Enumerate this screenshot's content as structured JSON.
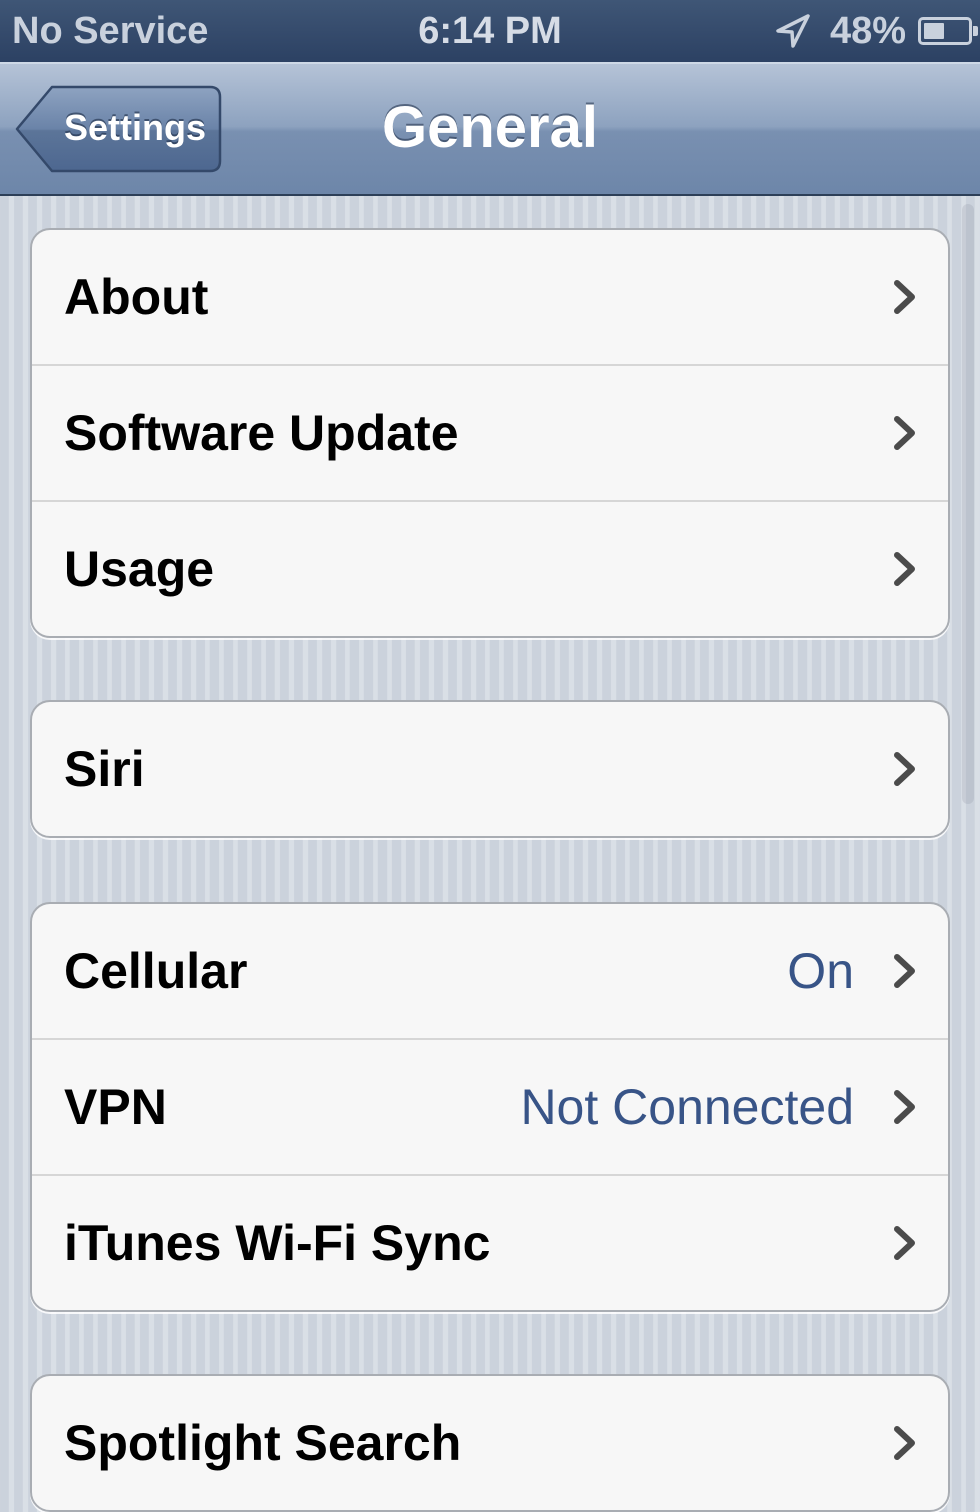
{
  "status_bar": {
    "carrier": "No Service",
    "time": "6:14 PM",
    "battery_percent": "48%",
    "battery_level": 0.48,
    "location_icon": "location-arrow-icon",
    "battery_icon": "battery-icon"
  },
  "nav_bar": {
    "back_label": "Settings",
    "title": "General"
  },
  "groups": [
    {
      "rows": [
        {
          "label": "About",
          "value": "",
          "icon": "chevron-right-icon"
        },
        {
          "label": "Software Update",
          "value": "",
          "icon": "chevron-right-icon"
        },
        {
          "label": "Usage",
          "value": "",
          "icon": "chevron-right-icon"
        }
      ]
    },
    {
      "rows": [
        {
          "label": "Siri",
          "value": "",
          "icon": "chevron-right-icon"
        }
      ]
    },
    {
      "rows": [
        {
          "label": "Cellular",
          "value": "On",
          "icon": "chevron-right-icon"
        },
        {
          "label": "VPN",
          "value": "Not Connected",
          "icon": "chevron-right-icon"
        },
        {
          "label": "iTunes Wi-Fi Sync",
          "value": "",
          "icon": "chevron-right-icon"
        }
      ]
    },
    {
      "rows": [
        {
          "label": "Spotlight Search",
          "value": "",
          "icon": "chevron-right-icon"
        }
      ]
    }
  ],
  "colors": {
    "value_text": "#385487",
    "nav_bar_top": "#b5c3d7",
    "nav_bar_bottom": "#6d86a9",
    "status_bar": "#2c4163"
  }
}
